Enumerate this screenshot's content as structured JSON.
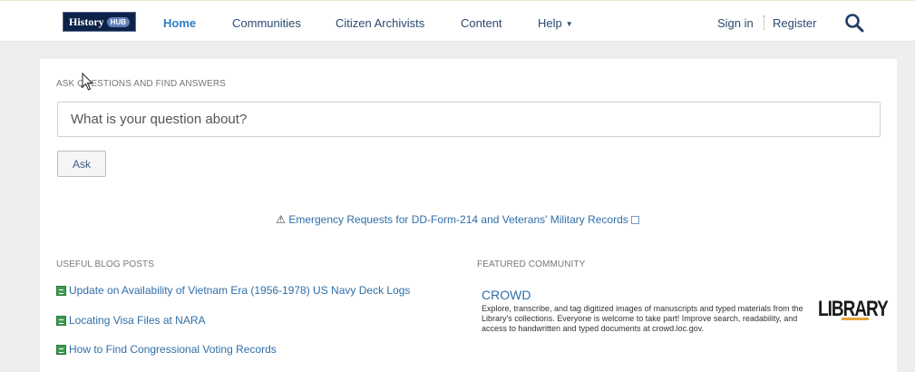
{
  "header": {
    "logo": {
      "text": "History",
      "badge": "HUB"
    },
    "nav": [
      {
        "label": "Home",
        "active": true
      },
      {
        "label": "Communities",
        "active": false
      },
      {
        "label": "Citizen Archivists",
        "active": false
      },
      {
        "label": "Content",
        "active": false
      },
      {
        "label": "Help",
        "active": false,
        "has_dropdown": true
      }
    ],
    "sign_in": "Sign in",
    "register": "Register",
    "search_icon": "search-icon"
  },
  "ask": {
    "label": "ASK QUESTIONS AND FIND ANSWERS",
    "placeholder": "What is your question about?",
    "button": "Ask"
  },
  "emergency": {
    "icon": "⚠",
    "link": "Emergency Requests for DD-Form-214 and Veterans' Military Records"
  },
  "blog": {
    "label": "USEFUL BLOG POSTS",
    "posts": [
      "Update on Availability of Vietnam Era (1956-1978) US Navy Deck Logs",
      "Locating Visa Files at NARA",
      "How to Find Congressional Voting Records"
    ]
  },
  "featured": {
    "label": "FEATURED COMMUNITY",
    "title": "CROWD",
    "description": "Explore, transcribe, and tag digitized images of manuscripts and typed materials from the Library's collections. Everyone is welcome to take part! Improve search, readability, and access to handwritten and typed documents at crowd.loc.gov.",
    "logo_text": "LIBRARY"
  },
  "colors": {
    "link": "#2f6ea8",
    "nav_active": "#2f7dc0",
    "logo_bg": "#0d2248",
    "blog_icon": "#3f9b54"
  }
}
